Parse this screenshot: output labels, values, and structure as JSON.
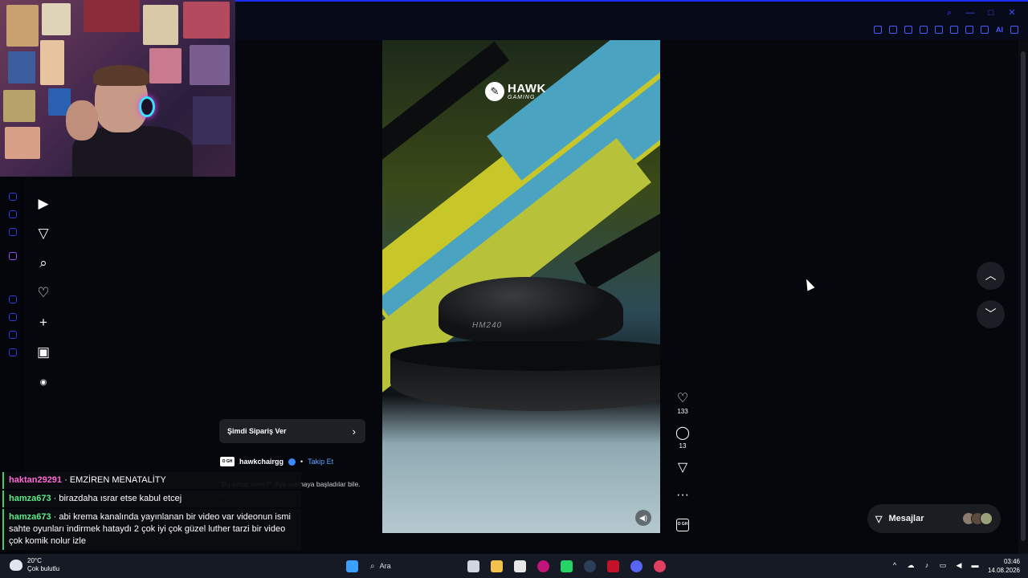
{
  "browser": {
    "ext_ai_label": "AI"
  },
  "reel": {
    "brand_main": "HAWK",
    "brand_sub": "GAMING",
    "mouse_model": "HM240",
    "likes": "133",
    "comments": "13",
    "account_badge": "O GH"
  },
  "order_card": {
    "label": "Şimdi Sipariş Ver"
  },
  "account": {
    "name": "hawkchairgg",
    "separator": "•",
    "follow_label": "Takip Et",
    "avatar_text": "O GH"
  },
  "caption": {
    "text": "\"Bu setup neee?\" diye sormaya başladılar bile.",
    "more": "..."
  },
  "chat": [
    {
      "user": "haktan29291",
      "sep": " · ",
      "message": "EMZİREN MENATALİTY",
      "color": "#ff6ad5"
    },
    {
      "user": "hamza673",
      "sep": " · ",
      "message": "birazdaha ısrar etse kabul etcej",
      "color": "#5dea8b"
    },
    {
      "user": "hamza673",
      "sep": " · ",
      "message": "abi krema kanalında yayınlanan bir video var videonun ismi sahte oyunları indirmek hataydı 2 çok iyi çok güzel luther tarzi bir video çok komik nolur izle",
      "color": "#5dea8b"
    }
  ],
  "messages": {
    "label": "Mesajlar"
  },
  "taskbar": {
    "temp": "20°C",
    "weather": "Çok bulutlu",
    "search": "Ara",
    "time": "03:46",
    "date": "14.08.2026"
  },
  "icons": {
    "sidebar": [
      "reels-icon",
      "send-icon",
      "search-icon",
      "heart-icon",
      "plus-icon",
      "insights-icon",
      "more-icon"
    ],
    "actions": [
      "heart-icon",
      "comment-icon",
      "share-icon",
      "more-icon"
    ]
  },
  "colors": {
    "accent": "#1a2cff",
    "chat_pink": "#ff6ad5",
    "chat_green": "#5dea8b",
    "follow": "#58a8ff"
  }
}
